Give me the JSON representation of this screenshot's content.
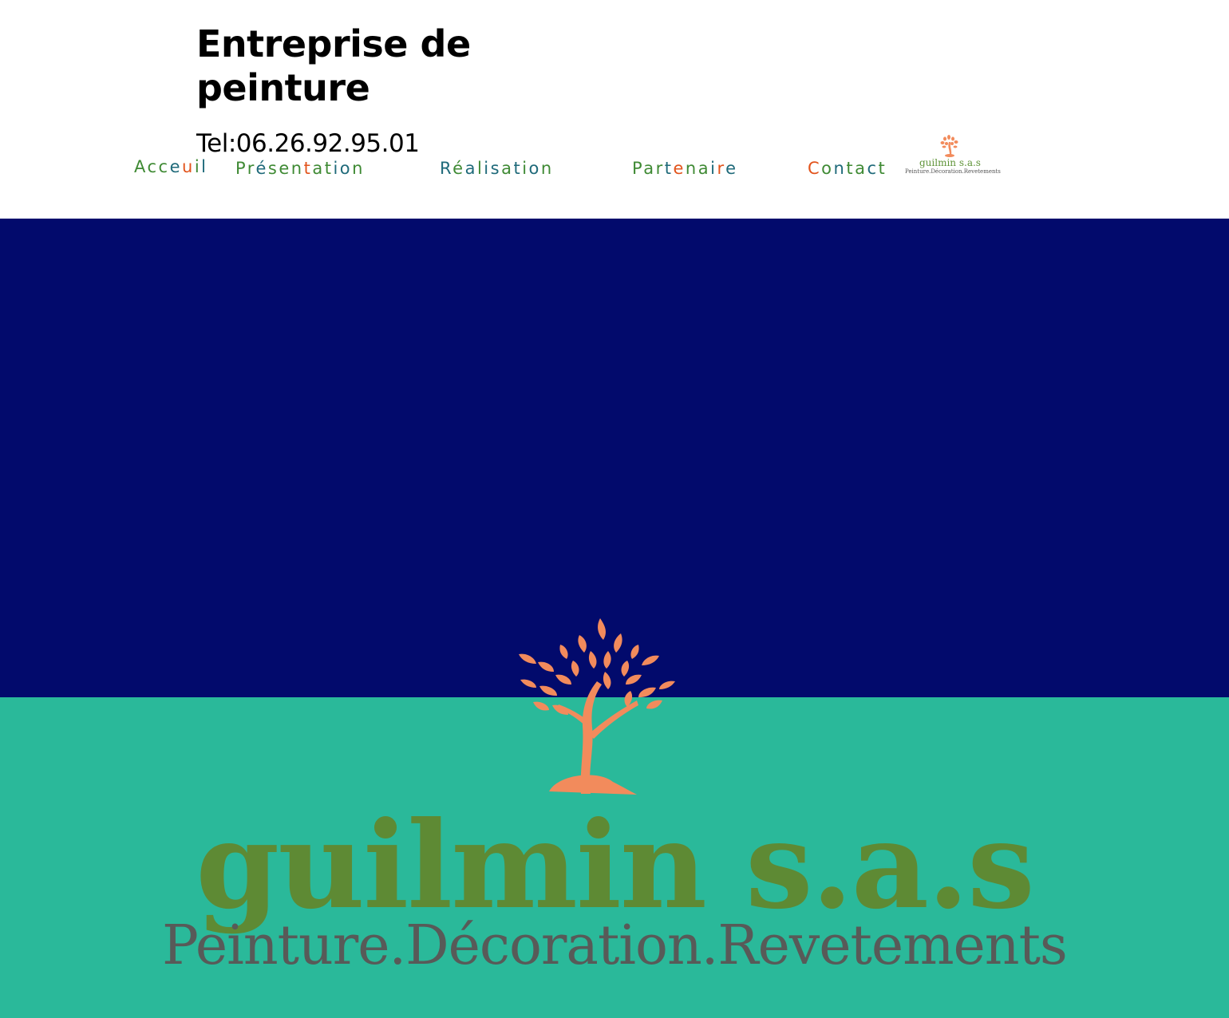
{
  "header": {
    "title": "Entreprise de peinture",
    "phone": "Tel:06.26.92.95.01"
  },
  "nav": [
    {
      "label": "Acceuil",
      "palette": [
        "#3f8a34",
        "#3f8a34",
        "#3f8a34",
        "#1f6a7a",
        "#e2541c",
        "#3f8a34",
        "#1f6a7a"
      ]
    },
    {
      "label": "Présentation",
      "palette": [
        "#3f8a34",
        "#3f8a34",
        "#1f6a7a",
        "#3f8a34",
        "#3f8a34",
        "#3f8a34",
        "#e2541c",
        "#3f8a34",
        "#3f8a34",
        "#1f6a7a",
        "#1f6a7a",
        "#3f8a34"
      ]
    },
    {
      "label": "Réalisation",
      "palette": [
        "#1f6a7a",
        "#3f8a34",
        "#1f6a7a",
        "#3f8a34",
        "#1f6a7a",
        "#1f6a7a",
        "#3f8a34",
        "#1f6a7a",
        "#3f8a34",
        "#1f6a7a",
        "#3f8a34"
      ]
    },
    {
      "label": "Partenaire",
      "palette": [
        "#3f8a34",
        "#3f8a34",
        "#3f8a34",
        "#1f6a7a",
        "#e2541c",
        "#3f8a34",
        "#3f8a34",
        "#1f6a7a",
        "#e2541c",
        "#1f6a7a"
      ]
    },
    {
      "label": "Contact",
      "palette": [
        "#e2541c",
        "#3f8a34",
        "#1f6a7a",
        "#3f8a34",
        "#3f8a34",
        "#1f6a7a",
        "#3f8a34"
      ]
    }
  ],
  "small_logo": {
    "name": "guilmin s.a.s",
    "tagline": "Peinture.Décoration.Revetements"
  },
  "hero": {
    "brand_name": "guilmin s.a.s",
    "tagline": "Peinture.Décoration.Revetements",
    "colors": {
      "band_top": "#020a6c",
      "band_bottom": "#2ab99a",
      "tree": "#f28b5c",
      "brand_name": "#5e8a34",
      "tagline": "#585a58"
    }
  }
}
